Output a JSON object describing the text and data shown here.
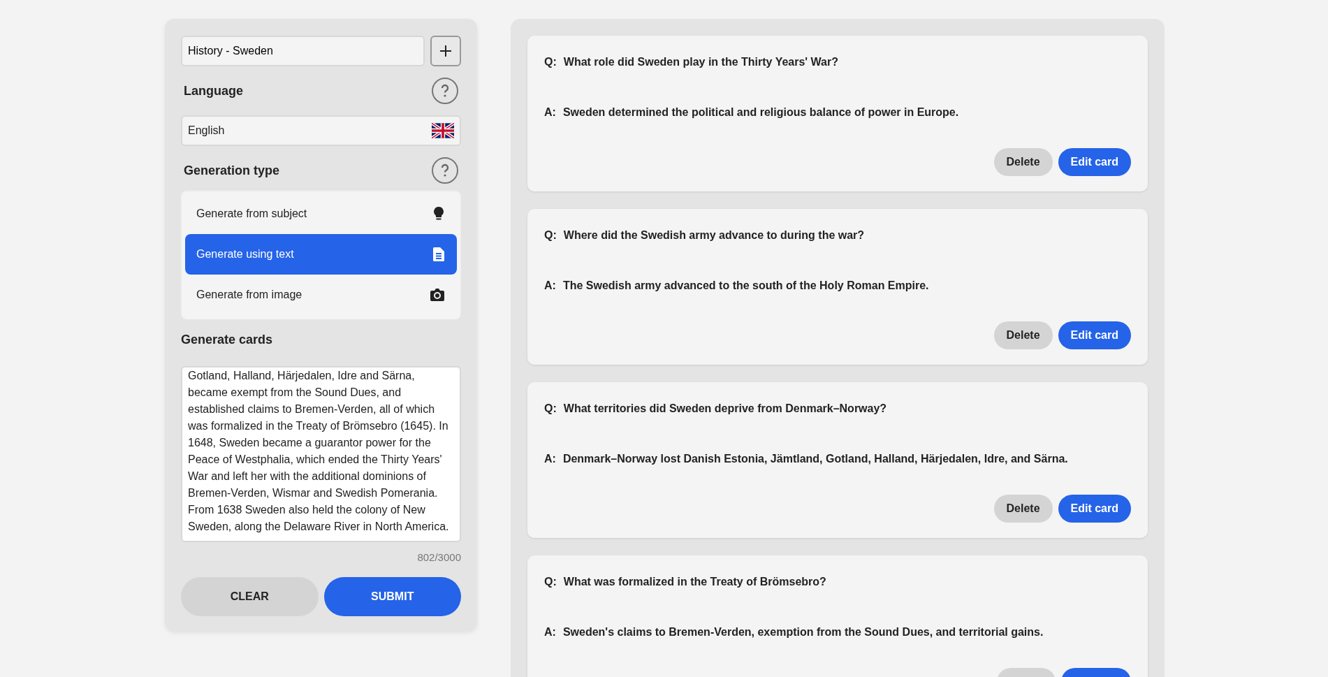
{
  "deck": {
    "value": "History - Sweden"
  },
  "language": {
    "label": "Language",
    "value": "English"
  },
  "generation_type": {
    "label": "Generation type",
    "options": [
      {
        "label": "Generate from subject",
        "kind": "subject",
        "selected": false
      },
      {
        "label": "Generate using text",
        "kind": "text",
        "selected": true
      },
      {
        "label": "Generate from image",
        "kind": "image",
        "selected": false
      }
    ]
  },
  "generate": {
    "label": "Generate cards",
    "text": "Gotland, Halland, Härjedalen, Idre and Särna, became exempt from the Sound Dues, and established claims to Bremen-Verden, all of which was formalized in the Treaty of Brömsebro (1645). In 1648, Sweden became a guarantor power for the Peace of Westphalia, which ended the Thirty Years' War and left her with the additional dominions of Bremen-Verden, Wismar and Swedish Pomerania. From 1638 Sweden also held the colony of New Sweden, along the Delaware River in North America.",
    "counter": "802/3000",
    "buttons": [
      {
        "label": "CLEAR",
        "kind": "secondary"
      },
      {
        "label": "SUBMIT",
        "kind": "primary"
      }
    ]
  },
  "cards": [
    {
      "q_marker": "Q:",
      "question": "What role did Sweden play in the Thirty Years' War?",
      "a_marker": "A:",
      "answer": "Sweden determined the political and religious balance of power in Europe.",
      "buttons": [
        {
          "kind": "delete",
          "label": "Delete"
        },
        {
          "kind": "edit",
          "label": "Edit card"
        }
      ]
    },
    {
      "q_marker": "Q:",
      "question": "Where did the Swedish army advance to during the war?",
      "a_marker": "A:",
      "answer": "The Swedish army advanced to the south of the Holy Roman Empire.",
      "buttons": [
        {
          "kind": "delete",
          "label": "Delete"
        },
        {
          "kind": "edit",
          "label": "Edit card"
        }
      ]
    },
    {
      "q_marker": "Q:",
      "question": "What territories did Sweden deprive from Denmark–Norway?",
      "a_marker": "A:",
      "answer": "Denmark–Norway lost Danish Estonia, Jämtland, Gotland, Halland, Härjedalen, Idre, and Särna.",
      "buttons": [
        {
          "kind": "delete",
          "label": "Delete"
        },
        {
          "kind": "edit",
          "label": "Edit card"
        }
      ]
    },
    {
      "q_marker": "Q:",
      "question": "What was formalized in the Treaty of Brömsebro?",
      "a_marker": "A:",
      "answer": "Sweden's claims to Bremen-Verden, exemption from the Sound Dues, and territorial gains.",
      "buttons": [
        {
          "kind": "delete"
        },
        {
          "kind": "edit"
        }
      ]
    }
  ]
}
